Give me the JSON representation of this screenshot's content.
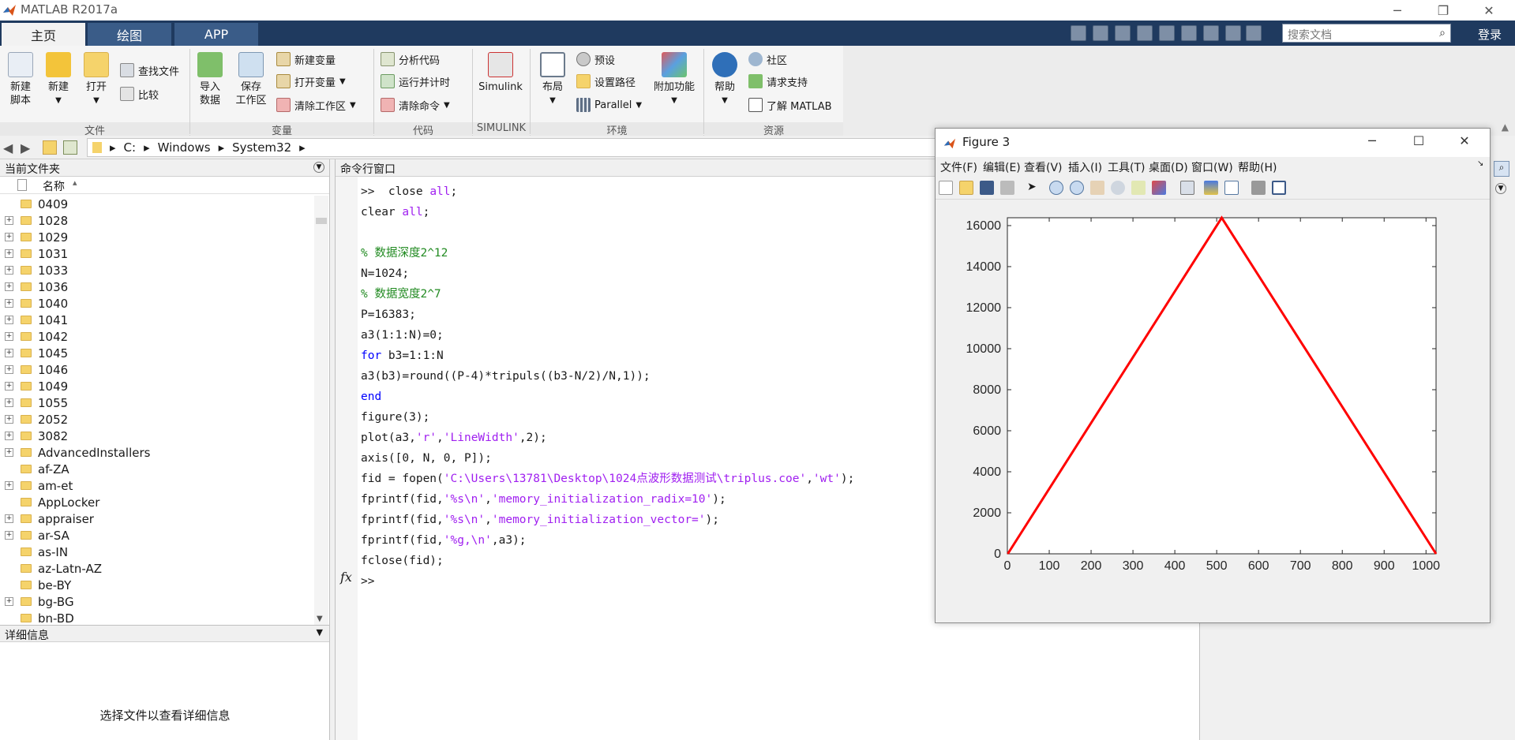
{
  "window": {
    "title": "MATLAB R2017a",
    "controls": [
      "minimize",
      "restore",
      "close"
    ]
  },
  "tabs": [
    {
      "label": "主页",
      "active": true
    },
    {
      "label": "绘图",
      "active": false
    },
    {
      "label": "APP",
      "active": false
    }
  ],
  "search": {
    "placeholder": "搜索文档"
  },
  "login_label": "登录",
  "ribbon": {
    "file": {
      "new_script": "新建\n脚本",
      "new": "新建",
      "open": "打开",
      "find_files": "查找文件",
      "compare": "比较",
      "group": "文件"
    },
    "variable": {
      "import": "导入\n数据",
      "save_ws": "保存\n工作区",
      "new_var": "新建变量",
      "open_var": "打开变量",
      "clear_ws": "清除工作区",
      "group": "变量"
    },
    "code": {
      "analyze": "分析代码",
      "run_time": "运行并计时",
      "clear_cmd": "清除命令",
      "group": "代码"
    },
    "simulink": {
      "label": "Simulink",
      "group": "SIMULINK"
    },
    "env": {
      "layout": "布局",
      "prefs": "预设",
      "set_path": "设置路径",
      "parallel": "Parallel",
      "addons": "附加功能",
      "group": "环境"
    },
    "resources": {
      "help": "帮助",
      "community": "社区",
      "support": "请求支持",
      "learn": "了解 MATLAB",
      "group": "资源"
    }
  },
  "path": {
    "segments": [
      "C:",
      "Windows",
      "System32"
    ]
  },
  "folder_panel": {
    "title": "当前文件夹",
    "col_name": "名称",
    "sort_indicator": "▴",
    "items": [
      {
        "name": "0409",
        "expandable": false
      },
      {
        "name": "1028",
        "expandable": true
      },
      {
        "name": "1029",
        "expandable": true
      },
      {
        "name": "1031",
        "expandable": true
      },
      {
        "name": "1033",
        "expandable": true
      },
      {
        "name": "1036",
        "expandable": true
      },
      {
        "name": "1040",
        "expandable": true
      },
      {
        "name": "1041",
        "expandable": true
      },
      {
        "name": "1042",
        "expandable": true
      },
      {
        "name": "1045",
        "expandable": true
      },
      {
        "name": "1046",
        "expandable": true
      },
      {
        "name": "1049",
        "expandable": true
      },
      {
        "name": "1055",
        "expandable": true
      },
      {
        "name": "2052",
        "expandable": true
      },
      {
        "name": "3082",
        "expandable": true
      },
      {
        "name": "AdvancedInstallers",
        "expandable": true
      },
      {
        "name": "af-ZA",
        "expandable": false
      },
      {
        "name": "am-et",
        "expandable": true
      },
      {
        "name": "AppLocker",
        "expandable": false
      },
      {
        "name": "appraiser",
        "expandable": true
      },
      {
        "name": "ar-SA",
        "expandable": true
      },
      {
        "name": "as-IN",
        "expandable": false
      },
      {
        "name": "az-Latn-AZ",
        "expandable": false
      },
      {
        "name": "be-BY",
        "expandable": false
      },
      {
        "name": "bg-BG",
        "expandable": true
      },
      {
        "name": "bn-BD",
        "expandable": false
      }
    ]
  },
  "details_panel": {
    "title": "详细信息",
    "message": "选择文件以查看详细信息"
  },
  "command_window": {
    "title": "命令行窗口",
    "prompt": ">>",
    "fx_label": "fx",
    "lines": [
      [
        {
          "t": ">>  close ",
          "c": ""
        },
        {
          "t": "all",
          "c": "str"
        },
        {
          "t": ";",
          "c": ""
        }
      ],
      [
        {
          "t": "clear ",
          "c": ""
        },
        {
          "t": "all",
          "c": "str"
        },
        {
          "t": ";",
          "c": ""
        }
      ],
      [
        {
          "t": "",
          "c": ""
        }
      ],
      [
        {
          "t": "% 数据深度2^12",
          "c": "cm"
        }
      ],
      [
        {
          "t": "N=1024;",
          "c": ""
        }
      ],
      [
        {
          "t": "% 数据宽度2^7",
          "c": "cm"
        }
      ],
      [
        {
          "t": "P=16383;",
          "c": ""
        }
      ],
      [
        {
          "t": "a3(1:1:N)=0;",
          "c": ""
        }
      ],
      [
        {
          "t": "for",
          "c": "kw"
        },
        {
          "t": " b3=1:1:N",
          "c": ""
        }
      ],
      [
        {
          "t": "a3(b3)=round((P-4)*tripuls((b3-N/2)/N,1));",
          "c": ""
        }
      ],
      [
        {
          "t": "end",
          "c": "kw"
        }
      ],
      [
        {
          "t": "figure(3);",
          "c": ""
        }
      ],
      [
        {
          "t": "plot(a3,",
          "c": ""
        },
        {
          "t": "'r'",
          "c": "str"
        },
        {
          "t": ",",
          "c": ""
        },
        {
          "t": "'LineWidth'",
          "c": "str"
        },
        {
          "t": ",2);",
          "c": ""
        }
      ],
      [
        {
          "t": "axis([0, N, 0, P]);",
          "c": ""
        }
      ],
      [
        {
          "t": "fid = fopen(",
          "c": ""
        },
        {
          "t": "'C:\\Users\\13781\\Desktop\\1024点波形数据测试\\triplus.coe'",
          "c": "str"
        },
        {
          "t": ",",
          "c": ""
        },
        {
          "t": "'wt'",
          "c": "str"
        },
        {
          "t": ");",
          "c": ""
        }
      ],
      [
        {
          "t": "fprintf(fid,",
          "c": ""
        },
        {
          "t": "'%s\\n'",
          "c": "str"
        },
        {
          "t": ",",
          "c": ""
        },
        {
          "t": "'memory_initialization_radix=10'",
          "c": "str"
        },
        {
          "t": ");",
          "c": ""
        }
      ],
      [
        {
          "t": "fprintf(fid,",
          "c": ""
        },
        {
          "t": "'%s\\n'",
          "c": "str"
        },
        {
          "t": ",",
          "c": ""
        },
        {
          "t": "'memory_initialization_vector='",
          "c": "str"
        },
        {
          "t": ");",
          "c": ""
        }
      ],
      [
        {
          "t": "fprintf(fid,",
          "c": ""
        },
        {
          "t": "'%g,\\n'",
          "c": "str"
        },
        {
          "t": ",a3);",
          "c": ""
        }
      ],
      [
        {
          "t": "fclose(fid);",
          "c": ""
        }
      ],
      [
        {
          "t": ">>",
          "c": ""
        }
      ]
    ]
  },
  "figure": {
    "title": "Figure 3",
    "menu": [
      "文件(F)",
      "编辑(E)",
      "查看(V)",
      "插入(I)",
      "工具(T)",
      "桌面(D)",
      "窗口(W)",
      "帮助(H)"
    ]
  },
  "chart_data": {
    "type": "line",
    "x": [
      1,
      512,
      1024
    ],
    "series": [
      {
        "values": [
          0,
          16379,
          0
        ],
        "color": "#ff0000"
      }
    ],
    "xlim": [
      0,
      1024
    ],
    "ylim": [
      0,
      16383
    ],
    "xticks": [
      0,
      100,
      200,
      300,
      400,
      500,
      600,
      700,
      800,
      900,
      1000
    ],
    "yticks": [
      0,
      2000,
      4000,
      6000,
      8000,
      10000,
      12000,
      14000,
      16000
    ],
    "grid": false
  },
  "colors": {
    "accent": "#1f3a5f",
    "keyword": "#0000ff",
    "string": "#a020f0",
    "comment": "#228b22",
    "line": "#ff0000"
  }
}
